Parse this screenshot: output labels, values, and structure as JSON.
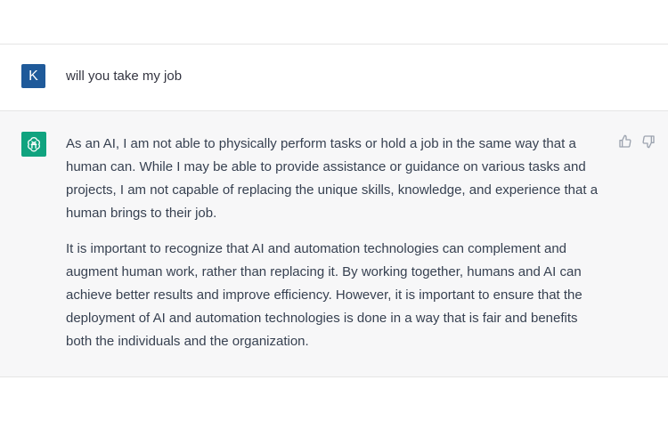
{
  "user": {
    "avatar_letter": "K",
    "message": "will you take my job"
  },
  "assistant": {
    "paragraphs": [
      "As an AI, I am not able to physically perform tasks or hold a job in the same way that a human can. While I may be able to provide assistance or guidance on various tasks and projects, I am not capable of replacing the unique skills, knowledge, and experience that a human brings to their job.",
      "It is important to recognize that AI and automation technologies can complement and augment human work, rather than replacing it. By working together, humans and AI can achieve better results and improve efficiency. However, it is important to ensure that the deployment of AI and automation technologies is done in a way that is fair and benefits both the individuals and the organization."
    ],
    "icons": [
      "openai-logo-icon",
      "thumbs-up-icon",
      "thumbs-down-icon"
    ]
  },
  "colors": {
    "user_avatar": "#1f5a9a",
    "assistant_logo": "#10a37f",
    "assistant_bg": "#f7f7f8"
  }
}
